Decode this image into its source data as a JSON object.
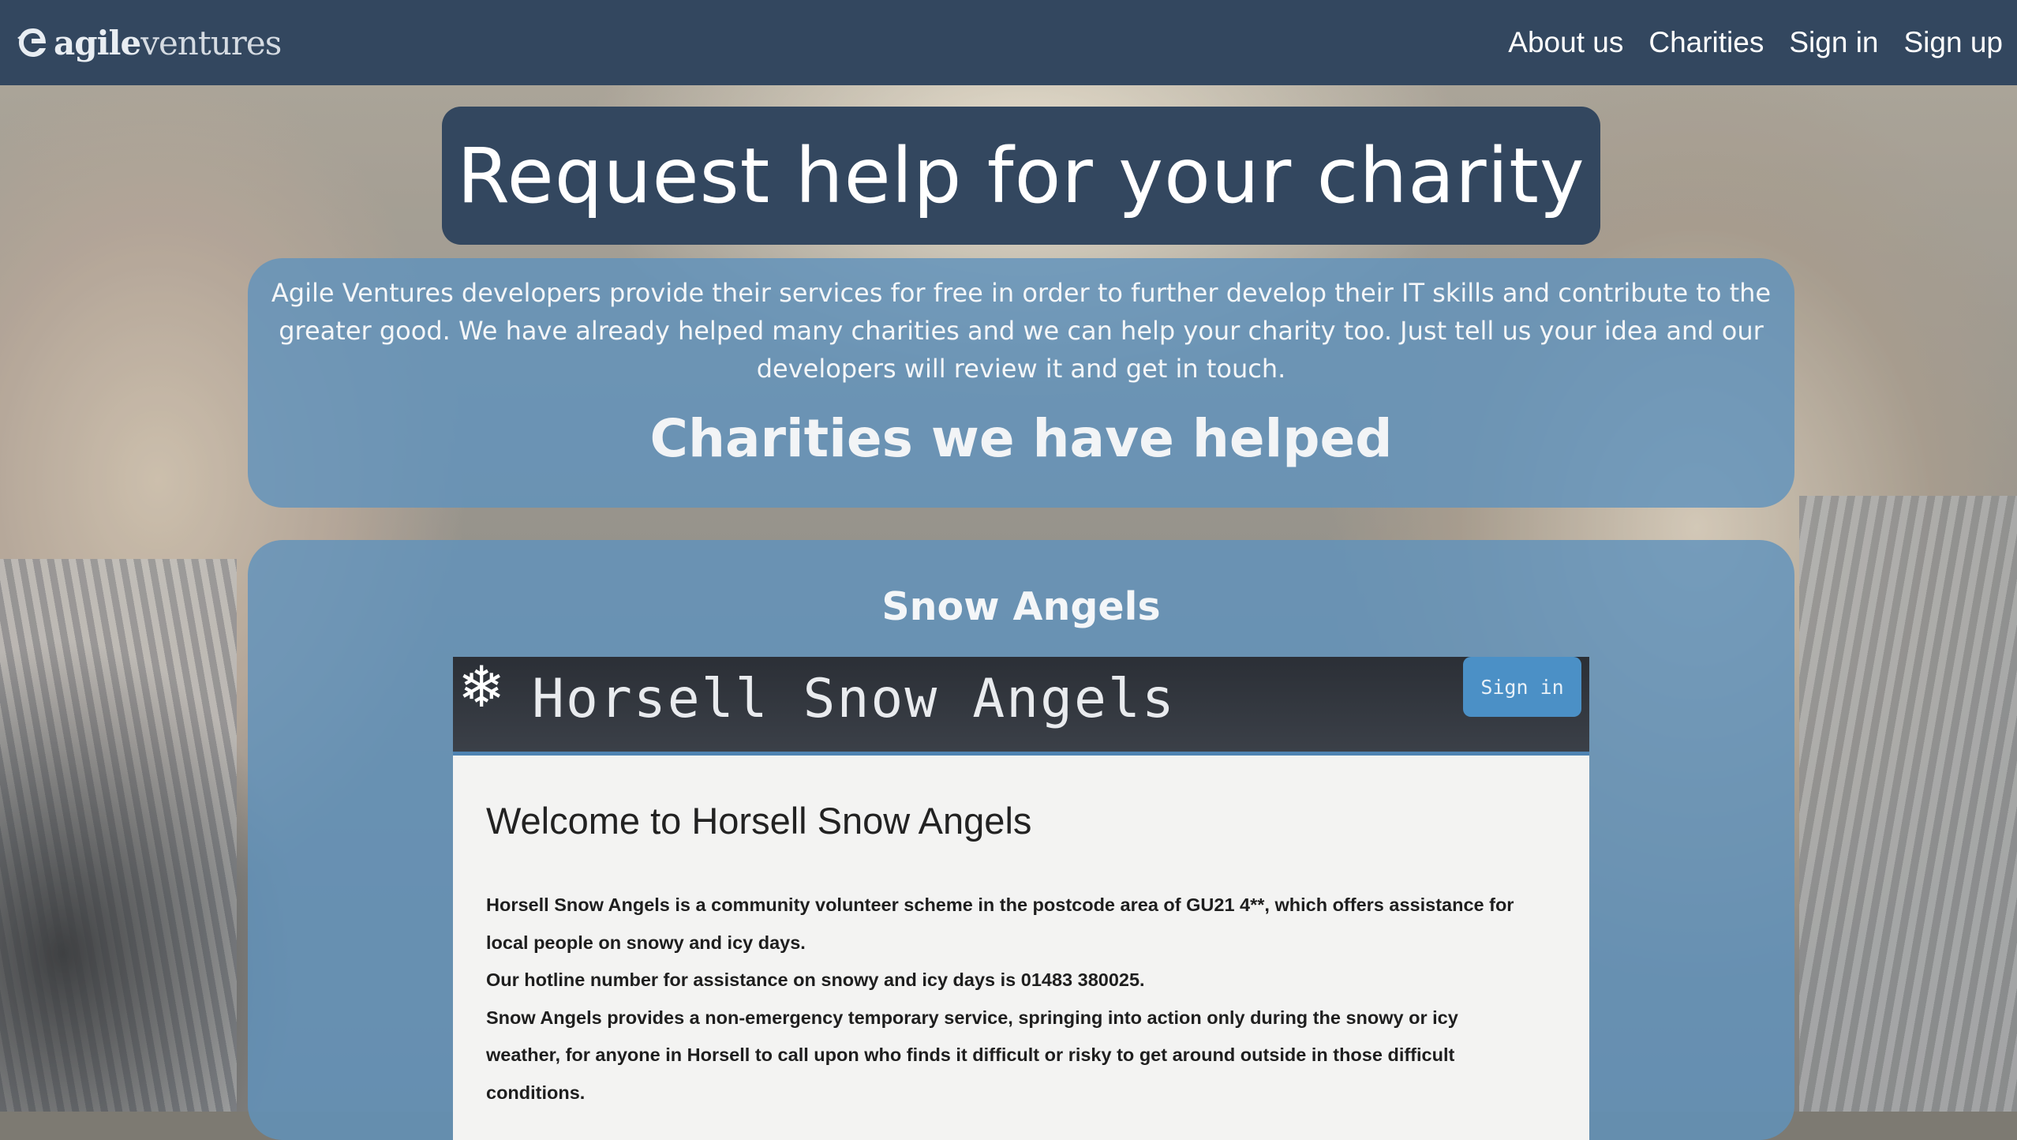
{
  "navbar": {
    "brand_bold": "agile",
    "brand_light": "ventures",
    "links": [
      "About us",
      "Charities",
      "Sign in",
      "Sign up"
    ]
  },
  "page": {
    "title": "Request help for your charity",
    "intro": "Agile Ventures developers provide their services for free in order to further develop their IT skills and contribute to the greater good. We have already helped many charities and we can help your charity too. Just tell us your idea and our developers will review it and get in touch.",
    "helped_heading": "Charities we have helped"
  },
  "charity": {
    "name": "Snow Angels",
    "screenshot": {
      "site_title": "Horsell Snow Angels",
      "signin_label": "Sign in",
      "welcome": "Welcome to Horsell Snow Angels",
      "lines": [
        "Horsell Snow Angels is a community volunteer scheme in the postcode area of GU21 4**, which offers assistance for",
        "local people on snowy and icy days.",
        "Our hotline number for assistance on snowy and icy days is 01483 380025.",
        "Snow Angels provides a non-emergency temporary service, springing into action only during the snowy or icy",
        "weather, for anyone in Horsell to call upon who finds it difficult or risky to get around outside in those difficult",
        "conditions."
      ]
    }
  },
  "colors": {
    "navbar": "#33475f",
    "panel": "#6093bc",
    "shot_header": "#2b2f36",
    "shot_signin": "#4b90c6"
  }
}
